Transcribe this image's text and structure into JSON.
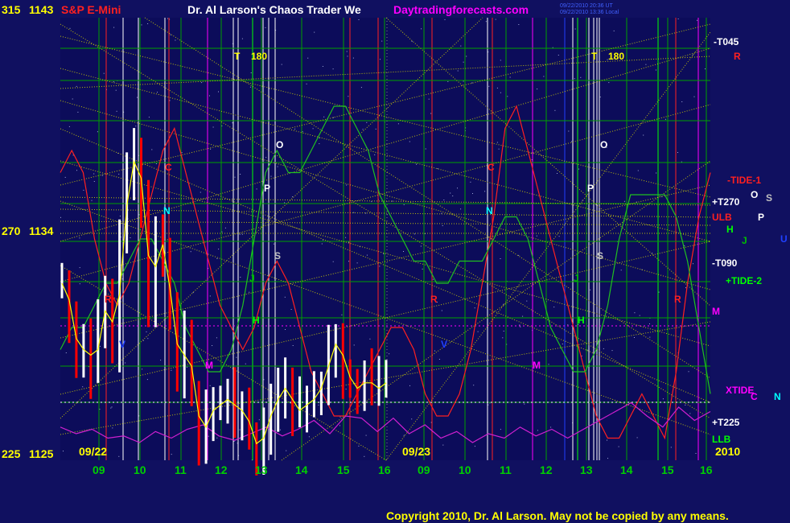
{
  "header": {
    "symbol": "S&P E-Mini",
    "author": "Dr. Al Larson's Chaos Trader We",
    "site": "Daytradingforecasts.com",
    "file": "spcctom.txt",
    "timestamp_ut": "09/22/2010 20:36 UT",
    "timestamp_local": "09/22/2010 13:36 Local"
  },
  "axis_left": {
    "ticks": [
      {
        "deg": "315",
        "price": "1143"
      },
      {
        "deg": "270",
        "price": "1134"
      },
      {
        "deg": "225",
        "price": "1125"
      }
    ]
  },
  "days": [
    {
      "label": "09/22",
      "hours": [
        "09",
        "10",
        "11",
        "12",
        "13",
        "14",
        "15",
        "16"
      ]
    },
    {
      "label": "09/23",
      "hours": [
        "09",
        "10",
        "11",
        "12",
        "13",
        "14",
        "15",
        "16"
      ]
    }
  ],
  "year": "2010",
  "copyright": "Copyright 2010, Dr. Al Larson. May not be copied by any means.",
  "right_labels": [
    {
      "text": "-T045",
      "color": "#ffffff"
    },
    {
      "text": "R",
      "color": "#ff2020"
    },
    {
      "text": "-TIDE-1",
      "color": "#ff2020"
    },
    {
      "text": "+T270",
      "color": "#ffffff"
    },
    {
      "text": "O",
      "color": "#ffffff"
    },
    {
      "text": "S",
      "color": "#c0c0c0"
    },
    {
      "text": "ULB",
      "color": "#ff2020"
    },
    {
      "text": "P",
      "color": "#ffffff"
    },
    {
      "text": "H",
      "color": "#00ff00"
    },
    {
      "text": "J",
      "color": "#00c000"
    },
    {
      "text": "U",
      "color": "#2040ff"
    },
    {
      "text": "-T090",
      "color": "#ffffff"
    },
    {
      "text": "+TIDE-2",
      "color": "#00ff00"
    },
    {
      "text": "M",
      "color": "#ff00ff"
    },
    {
      "text": "XTIDE",
      "color": "#ff00ff"
    },
    {
      "text": "C",
      "color": "#ff00ff"
    },
    {
      "text": "N",
      "color": "#00ffff"
    },
    {
      "text": "+T225",
      "color": "#ffffff"
    },
    {
      "text": "LLB",
      "color": "#00ff00"
    }
  ],
  "in_chart_labels": [
    {
      "text": "T",
      "color": "#ffff00"
    },
    {
      "text": "180",
      "color": "#ffff00"
    },
    {
      "text": "O",
      "color": "#ffffff"
    },
    {
      "text": "P",
      "color": "#ffffff"
    },
    {
      "text": "S",
      "color": "#c0c0c0"
    },
    {
      "text": "C",
      "color": "#ff2020"
    },
    {
      "text": "N",
      "color": "#00ffff"
    },
    {
      "text": "R",
      "color": "#ff2020"
    },
    {
      "text": "H",
      "color": "#00ff00"
    },
    {
      "text": "J",
      "color": "#00c000"
    },
    {
      "text": "M",
      "color": "#ff00ff"
    },
    {
      "text": "V",
      "color": "#2040ff"
    },
    {
      "text": "T",
      "color": "#ffff00"
    },
    {
      "text": "180",
      "color": "#ffff00"
    },
    {
      "text": "O",
      "color": "#ffffff"
    },
    {
      "text": "P",
      "color": "#ffffff"
    },
    {
      "text": "S",
      "color": "#c0c0c0"
    },
    {
      "text": "C",
      "color": "#ff2020"
    },
    {
      "text": "N",
      "color": "#00ffff"
    },
    {
      "text": "R",
      "color": "#ff2020"
    },
    {
      "text": "R",
      "color": "#ff2020"
    },
    {
      "text": "H",
      "color": "#00ff00"
    },
    {
      "text": "J",
      "color": "#00c000"
    },
    {
      "text": "M",
      "color": "#ff00ff"
    },
    {
      "text": "V",
      "color": "#2040ff"
    }
  ],
  "colors": {
    "background": "#101060",
    "grid": "#00a000",
    "price_up": "#ffffff",
    "price_down": "#ff0000",
    "average": "#ffff00",
    "gann": "#d8d800",
    "tide1": "#ff2020",
    "tide2": "#20c020",
    "xtide": "#d020d0",
    "header_red": "#ff2020",
    "header_white": "#ffffff",
    "site": "#ff00ff",
    "file": "#2050ff",
    "axis_text": "#ffff00"
  },
  "chart_data": {
    "type": "line",
    "series": [
      {
        "name": "S&P E-Mini",
        "values": [
          1133.0,
          1131.5,
          1129.5,
          1130.5,
          1129.0,
          1131.0,
          1132.5,
          1130.0,
          1135.0,
          1138.0,
          1139.0,
          1136.5,
          1132.0,
          1135.5,
          1134.0,
          1131.5,
          1129.0,
          1130.5,
          1128.0,
          1126.0,
          1127.0,
          1127.5,
          1127.5,
          1128.0,
          1127.0,
          1127.5,
          1126.0,
          1125.5,
          1126.5,
          1127.5,
          1128.0,
          1128.5,
          1127.0,
          1127.5,
          1127.5,
          1128.0,
          1128.5,
          1130.0,
          1130.5,
          1129.0,
          1128.5,
          1128.0,
          1129.0,
          1128.0,
          1128.5,
          1128.5
        ]
      },
      {
        "name": "TIDE-1",
        "values": [
          1138,
          1139,
          1138,
          1135,
          1133,
          1132,
          1133,
          1135,
          1137,
          1139,
          1140,
          1138,
          1136,
          1134,
          1132,
          1131,
          1130,
          1131,
          1133,
          1134,
          1133,
          1131,
          1129,
          1128,
          1127,
          1127,
          1128,
          1129,
          1130,
          1131,
          1131,
          1130,
          1128,
          1127,
          1127,
          1128,
          1130,
          1133,
          1136,
          1140,
          1141,
          1139,
          1137,
          1135,
          1133,
          1131,
          1129,
          1127,
          1126,
          1126,
          1127,
          1128,
          1127,
          1126,
          1129,
          1133,
          1136,
          1138
        ]
      },
      {
        "name": "TIDE-2",
        "values": [
          1130,
          1131,
          1131,
          1132,
          1133,
          1133,
          1134,
          1135,
          1135,
          1134,
          1133,
          1131,
          1130,
          1129,
          1129,
          1130,
          1132,
          1135,
          1138,
          1139,
          1138,
          1138,
          1139,
          1140,
          1141,
          1141,
          1140,
          1139,
          1137,
          1136,
          1135,
          1134,
          1134,
          1133,
          1133,
          1134,
          1134,
          1134,
          1135,
          1136,
          1136,
          1135,
          1133,
          1131,
          1130,
          1129,
          1129,
          1130,
          1132,
          1135,
          1137,
          1137,
          1137,
          1137,
          1136,
          1134,
          1131,
          1128
        ]
      },
      {
        "name": "XTIDE",
        "values": [
          1126.5,
          1126.2,
          1126.4,
          1126.0,
          1126.1,
          1125.8,
          1126.3,
          1126.0,
          1126.4,
          1126.6,
          1126.1,
          1125.9,
          1126.2,
          1126.5,
          1126.1,
          1126.4,
          1126.8,
          1126.2,
          1127.0,
          1126.9,
          1126.3,
          1126.9,
          1126.2,
          1126.6,
          1126.0,
          1126.3,
          1125.8,
          1126.2,
          1126.0,
          1126.5,
          1126.1,
          1126.4,
          1126.0,
          1126.4,
          1126.8,
          1127.2,
          1127.6,
          1127.0,
          1126.5,
          1127.4,
          1126.8,
          1127.2
        ]
      }
    ],
    "ylim": [
      1125,
      1145
    ],
    "grid": true,
    "legend": "right"
  }
}
